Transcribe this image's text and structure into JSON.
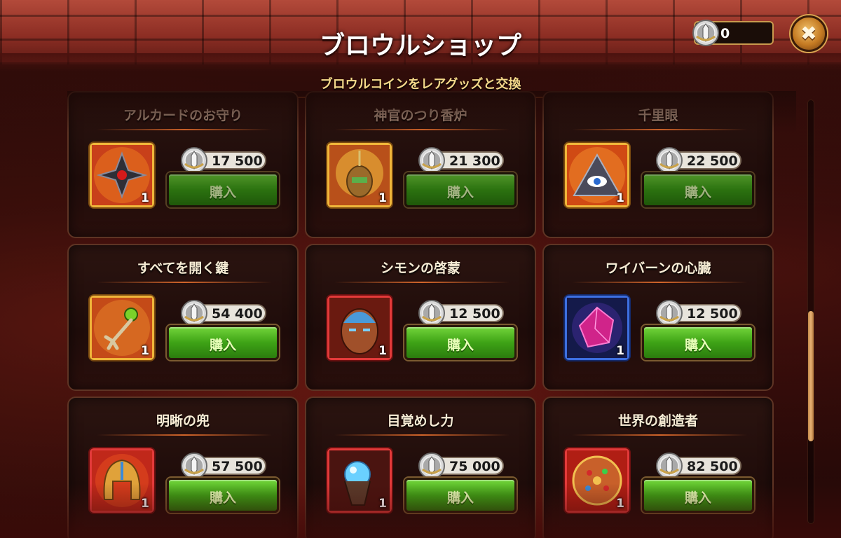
{
  "header": {
    "title": "ブロウルショップ",
    "subtitle": "ブロウルコインをレアグッズと交換",
    "coin_balance": "0",
    "close_glyph": "✖"
  },
  "buy_label": "購入",
  "items": [
    {
      "name": "アルカードのお守り",
      "price": "17 500",
      "qty": "1",
      "frame": "gold",
      "icon": "shuriken-amulet-icon",
      "dim": true
    },
    {
      "name": "神官のつり香炉",
      "price": "21 300",
      "qty": "1",
      "frame": "gold",
      "icon": "censer-icon",
      "dim": true
    },
    {
      "name": "千里眼",
      "price": "22 500",
      "qty": "1",
      "frame": "gold",
      "icon": "all-seeing-eye-icon",
      "dim": true
    },
    {
      "name": "すべてを開く鍵",
      "price": "54 400",
      "qty": "1",
      "frame": "gold",
      "icon": "claw-key-icon",
      "dim": false
    },
    {
      "name": "シモンの啓蒙",
      "price": "12 500",
      "qty": "1",
      "frame": "red",
      "icon": "glowing-head-icon",
      "dim": false
    },
    {
      "name": "ワイバーンの心臓",
      "price": "12 500",
      "qty": "1",
      "frame": "blue",
      "icon": "purple-crystal-icon",
      "dim": false
    },
    {
      "name": "明晰の兜",
      "price": "57 500",
      "qty": "1",
      "frame": "red",
      "icon": "golden-helmet-icon",
      "dim": false
    },
    {
      "name": "目覚めし力",
      "price": "75 000",
      "qty": "1",
      "frame": "red",
      "icon": "orb-claw-icon",
      "dim": false
    },
    {
      "name": "世界の創造者",
      "price": "82 500",
      "qty": "1",
      "frame": "red",
      "icon": "jeweled-orb-icon",
      "dim": false
    }
  ],
  "scrollbar": {
    "position": 0.72
  }
}
